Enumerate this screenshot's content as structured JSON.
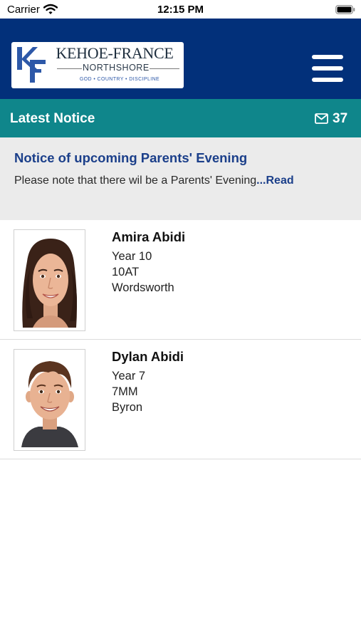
{
  "status_bar": {
    "carrier": "Carrier",
    "time": "12:15 PM"
  },
  "header": {
    "logo": {
      "monogram": "KF",
      "title": "KEHOE-FRANCE",
      "subtitle": "NORTHSHORE",
      "motto": "GOD • COUNTRY • DISCIPLINE",
      "colors": {
        "monogram": "#2d58a8",
        "text": "#1f2f3f"
      }
    },
    "menu_icon": "hamburger-menu-icon",
    "background": "#02307a"
  },
  "notice_bar": {
    "title": "Latest Notice",
    "icon": "envelope-icon",
    "count": "37",
    "background": "#0f868b"
  },
  "notice_preview": {
    "title": "Notice of upcoming Parents' Evening",
    "body": "Please note that there wil be a Parents' Evening",
    "read_more": "...Read"
  },
  "students": [
    {
      "name": "Amira Abidi",
      "year": "Year 10",
      "form": "10AT",
      "house": "Wordsworth"
    },
    {
      "name": "Dylan Abidi",
      "year": "Year 7",
      "form": "7MM",
      "house": "Byron"
    }
  ]
}
